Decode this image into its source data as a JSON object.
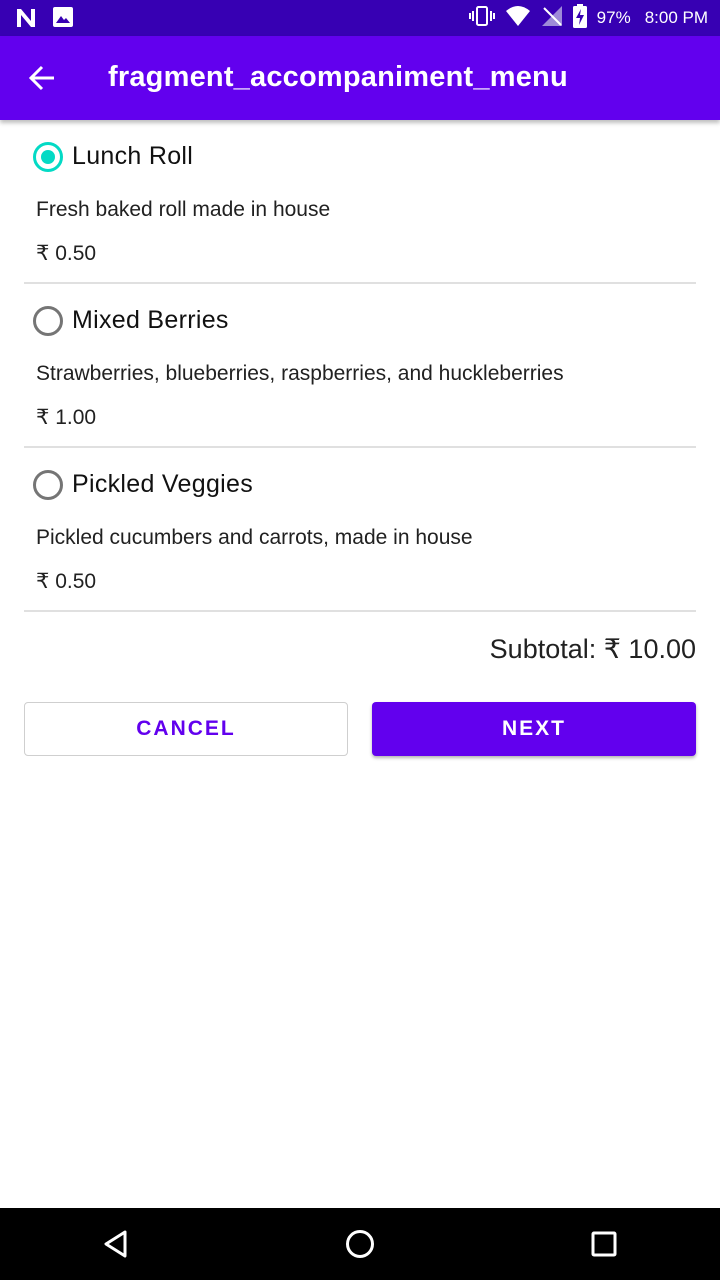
{
  "status_bar": {
    "battery": "97%",
    "time": "8:00 PM",
    "icons": [
      "n-notification-icon",
      "image-notification-icon",
      "vibrate-icon",
      "wifi-icon",
      "no-signal-icon",
      "battery-charging-icon"
    ]
  },
  "app_bar": {
    "title": "fragment_accompaniment_menu",
    "back_icon": "arrow-back-icon"
  },
  "menu": {
    "items": [
      {
        "name": "Lunch Roll",
        "description": "Fresh baked roll made in house",
        "price": "₹ 0.50",
        "selected": true
      },
      {
        "name": "Mixed Berries",
        "description": "Strawberries, blueberries, raspberries, and huckleberries",
        "price": "₹ 1.00",
        "selected": false
      },
      {
        "name": "Pickled Veggies",
        "description": "Pickled cucumbers and carrots, made in house",
        "price": "₹ 0.50",
        "selected": false
      }
    ]
  },
  "footer": {
    "subtotal": "Subtotal: ₹ 10.00",
    "cancel_label": "CANCEL",
    "next_label": "NEXT"
  },
  "colors": {
    "status_bar": "#3700b3",
    "primary": "#6200ee",
    "accent": "#03dac5"
  },
  "nav_bar": {
    "icons": [
      "nav-back-icon",
      "nav-home-icon",
      "nav-recents-icon"
    ]
  }
}
